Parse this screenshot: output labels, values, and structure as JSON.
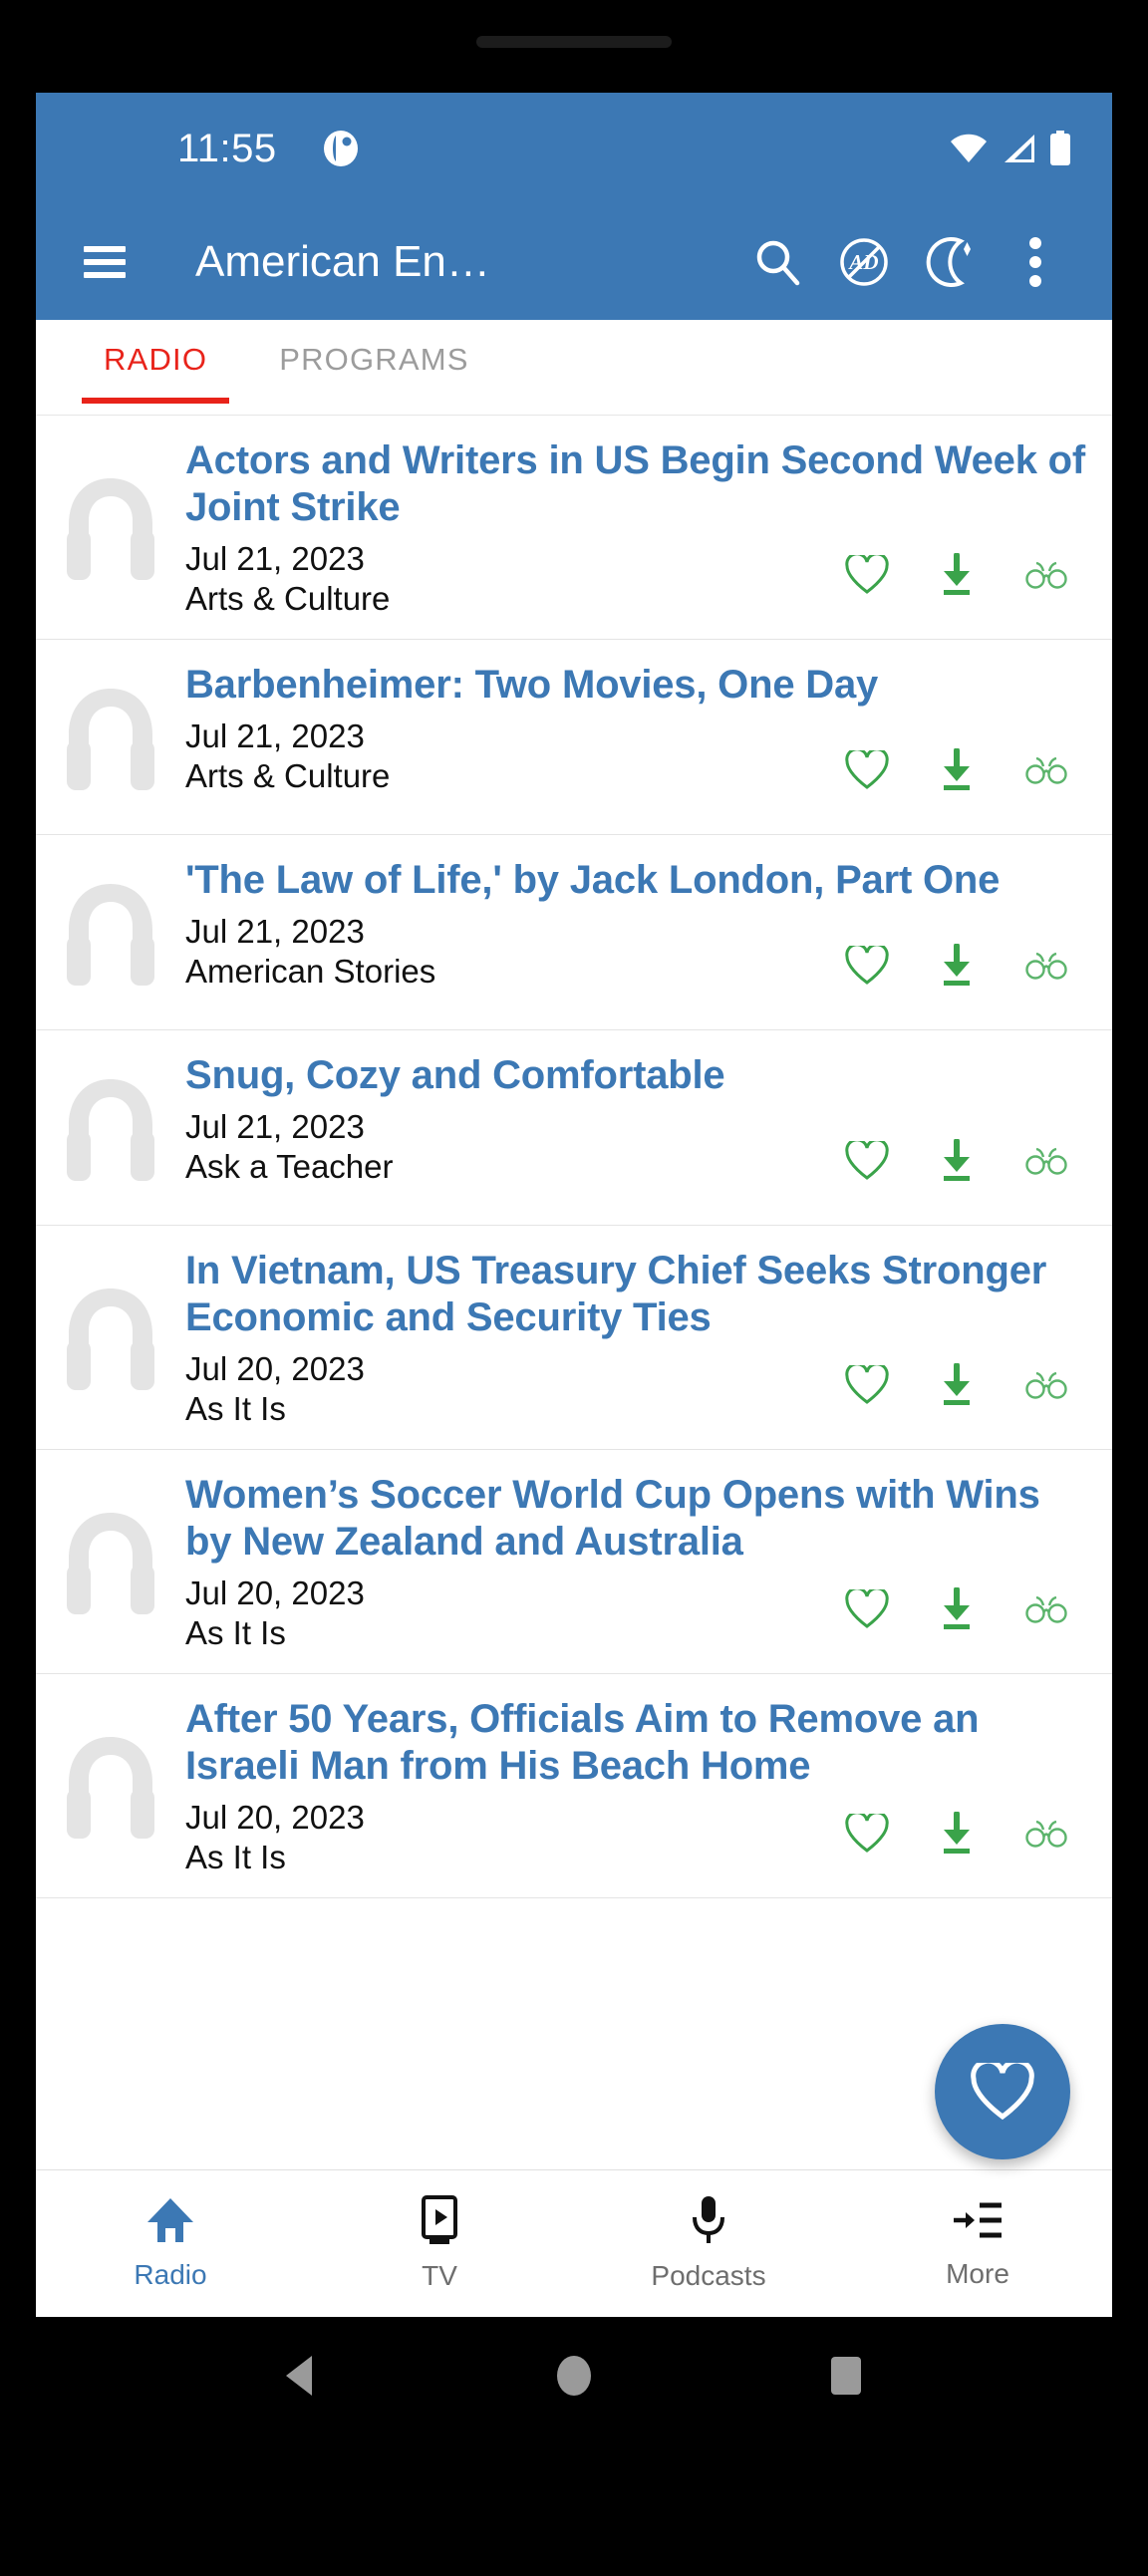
{
  "status_bar": {
    "time": "11:55",
    "app_icon": "voa-logo-icon",
    "icons": [
      "wifi-icon",
      "cellular-signal-icon",
      "battery-full-icon"
    ],
    "background": "#3c78b4"
  },
  "app_bar": {
    "menu_icon": "hamburger-menu-icon",
    "title": "American En…",
    "actions": [
      {
        "name": "search-icon",
        "label": "Search"
      },
      {
        "name": "no-ads-icon",
        "label": "AD"
      },
      {
        "name": "night-mode-icon",
        "label": "Night mode"
      },
      {
        "name": "overflow-menu-icon",
        "label": "More options"
      }
    ]
  },
  "tabs": [
    {
      "label": "RADIO",
      "active": true,
      "color": "#e8231a"
    },
    {
      "label": "PROGRAMS",
      "active": false,
      "color": "#9c9c9c"
    }
  ],
  "articles": [
    {
      "title": "Actors and Writers in US Begin Second Week of Joint Strike",
      "date": "Jul 21, 2023",
      "category": "Arts & Culture"
    },
    {
      "title": "Barbenheimer: Two Movies, One Day",
      "date": "Jul 21, 2023",
      "category": "Arts & Culture"
    },
    {
      "title": "'The Law of Life,' by Jack London, Part One",
      "date": "Jul 21, 2023",
      "category": "American Stories"
    },
    {
      "title": "Snug, Cozy and Comfortable",
      "date": "Jul 21, 2023",
      "category": "Ask a Teacher"
    },
    {
      "title": "In Vietnam, US Treasury Chief Seeks Stronger Economic and Security Ties",
      "date": "Jul 20, 2023",
      "category": "As It Is"
    },
    {
      "title": "Women’s Soccer World Cup Opens with Wins by New Zealand and Australia",
      "date": "Jul 20, 2023",
      "category": "As It Is"
    },
    {
      "title": "After 50 Years, Officials Aim to Remove an Israeli Man from His Beach Home",
      "date": "Jul 20, 2023",
      "category": "As It Is"
    }
  ],
  "row_actions": [
    {
      "name": "favorite-heart-icon",
      "label": "Favorite"
    },
    {
      "name": "download-icon",
      "label": "Download"
    },
    {
      "name": "read-glasses-icon",
      "label": "Read"
    }
  ],
  "fab": {
    "name": "favorites-fab",
    "icon": "heart-icon",
    "color": "#3c78b4"
  },
  "bottom_nav": [
    {
      "label": "Radio",
      "icon": "home-icon",
      "active": true
    },
    {
      "label": "TV",
      "icon": "tv-play-icon",
      "active": false
    },
    {
      "label": "Podcasts",
      "icon": "microphone-icon",
      "active": false
    },
    {
      "label": "More",
      "icon": "more-list-icon",
      "active": false
    }
  ],
  "system_nav": [
    {
      "name": "back-button",
      "icon": "triangle-back-icon"
    },
    {
      "name": "home-button",
      "icon": "circle-home-icon"
    },
    {
      "name": "recents-button",
      "icon": "square-recents-icon"
    }
  ],
  "colors": {
    "brand_blue": "#3c78b4",
    "accent_red": "#e8231a",
    "action_green": "#3aa34a",
    "thumb_gray": "#e4e4e4"
  }
}
